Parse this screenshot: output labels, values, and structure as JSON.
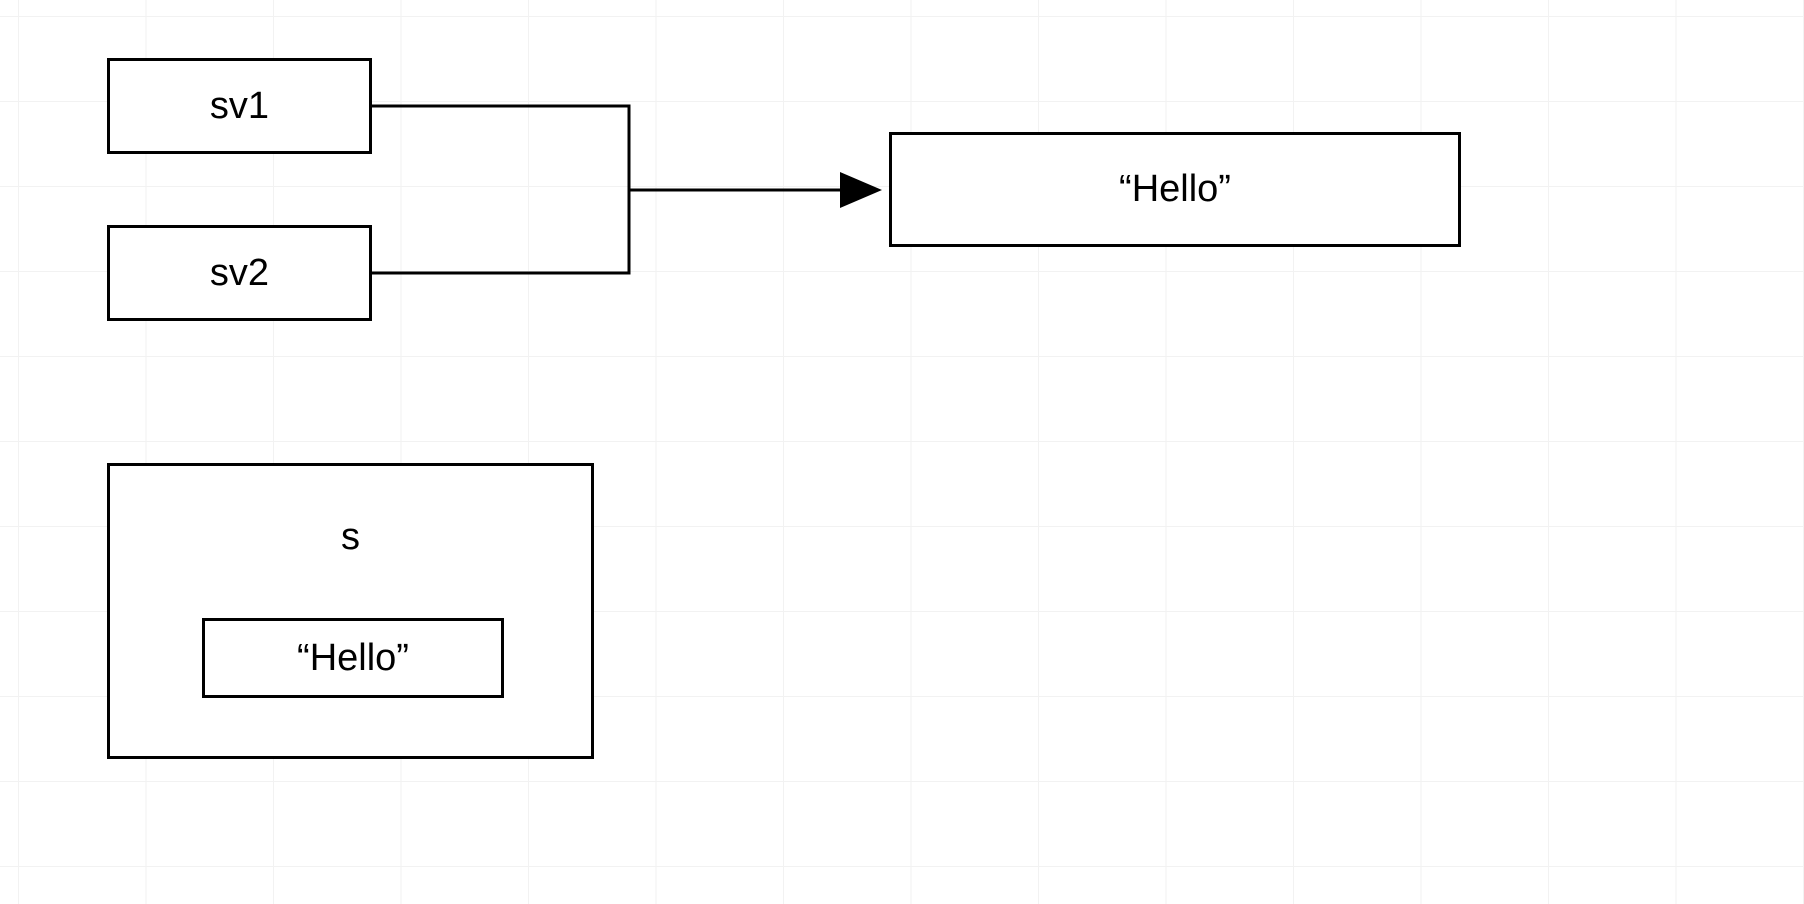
{
  "nodes": {
    "sv1": {
      "label": "sv1"
    },
    "sv2": {
      "label": "sv2"
    },
    "hello_right": {
      "label": "“Hello”"
    },
    "s_outer": {
      "label": "s"
    },
    "hello_inner": {
      "label": "“Hello”"
    }
  },
  "connectors": {
    "sv1_to_merge": {
      "from": "sv1",
      "to": "merge_point"
    },
    "sv2_to_merge": {
      "from": "sv2",
      "to": "merge_point"
    },
    "merge_to_hello": {
      "from": "merge_point",
      "to": "hello_right",
      "arrow": true
    }
  }
}
